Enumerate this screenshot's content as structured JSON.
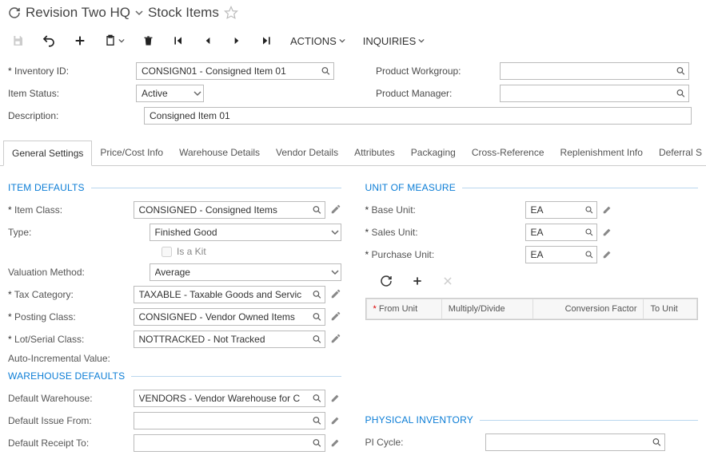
{
  "title": {
    "company": "Revision Two HQ",
    "screen": "Stock Items"
  },
  "toolbar": {
    "actions_label": "ACTIONS",
    "inquiries_label": "INQUIRIES"
  },
  "header": {
    "inventory_id_label": "Inventory ID:",
    "inventory_id_value": "CONSIGN01 - Consigned Item 01",
    "item_status_label": "Item Status:",
    "item_status_value": "Active",
    "description_label": "Description:",
    "description_value": "Consigned Item 01",
    "product_workgroup_label": "Product Workgroup:",
    "product_workgroup_value": "",
    "product_manager_label": "Product Manager:",
    "product_manager_value": ""
  },
  "tabs": [
    "General Settings",
    "Price/Cost Info",
    "Warehouse Details",
    "Vendor Details",
    "Attributes",
    "Packaging",
    "Cross-Reference",
    "Replenishment Info",
    "Deferral S"
  ],
  "defaults": {
    "section": "ITEM DEFAULTS",
    "item_class_label": "Item Class:",
    "item_class_value": "CONSIGNED - Consigned Items",
    "type_label": "Type:",
    "type_value": "Finished Good",
    "is_kit_label": "Is a Kit",
    "valuation_label": "Valuation Method:",
    "valuation_value": "Average",
    "tax_cat_label": "Tax Category:",
    "tax_cat_value": "TAXABLE - Taxable Goods and Servic",
    "posting_label": "Posting Class:",
    "posting_value": "CONSIGNED - Vendor Owned Items",
    "lot_label": "Lot/Serial Class:",
    "lot_value": "NOTTRACKED - Not Tracked",
    "auto_inc_label": "Auto-Incremental Value:"
  },
  "warehouse": {
    "section": "WAREHOUSE DEFAULTS",
    "default_wh_label": "Default Warehouse:",
    "default_wh_value": "VENDORS - Vendor Warehouse for C",
    "issue_label": "Default Issue From:",
    "issue_value": "",
    "receipt_label": "Default Receipt To:",
    "receipt_value": ""
  },
  "uom": {
    "section": "UNIT OF MEASURE",
    "base_label": "Base Unit:",
    "base_value": "EA",
    "sales_label": "Sales Unit:",
    "sales_value": "EA",
    "purchase_label": "Purchase Unit:",
    "purchase_value": "EA",
    "grid_headers": {
      "from": "From Unit",
      "md": "Multiply/Divide",
      "cf": "Conversion Factor",
      "to": "To Unit"
    }
  },
  "pi": {
    "section": "PHYSICAL INVENTORY",
    "cycle_label": "PI Cycle:",
    "cycle_value": ""
  }
}
